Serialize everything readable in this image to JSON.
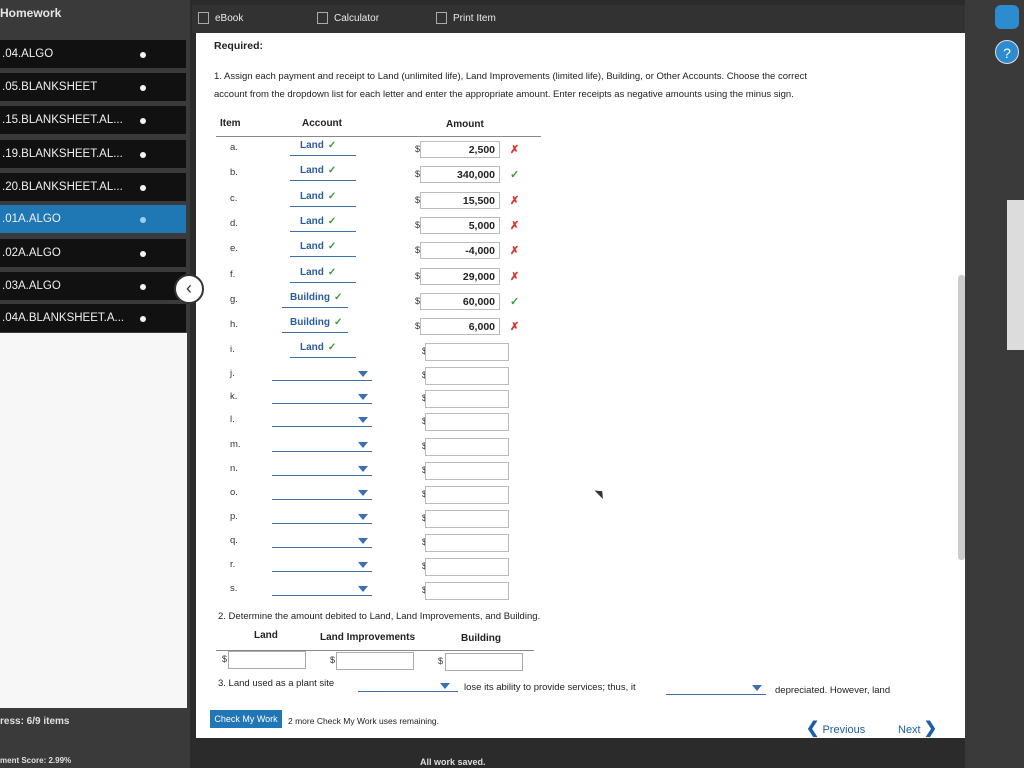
{
  "sidebar": {
    "title": "Homework",
    "items": [
      {
        "label": ".04.ALGO"
      },
      {
        "label": ".05.BLANKSHEET"
      },
      {
        "label": ".15.BLANKSHEET.AL..."
      },
      {
        "label": ".19.BLANKSHEET.AL..."
      },
      {
        "label": ".20.BLANKSHEET.AL..."
      },
      {
        "label": ".01A.ALGO"
      },
      {
        "label": ".02A.ALGO"
      },
      {
        "label": ".03A.ALGO"
      },
      {
        "label": ".04A.BLANKSHEET.A..."
      }
    ],
    "progress": "ress: 6/9 items",
    "score": "ment Score: 2.99%"
  },
  "toolbar": {
    "ebook": "eBook",
    "calculator": "Calculator",
    "print": "Print Item"
  },
  "main": {
    "required": "Required:",
    "q1_line1": "1. Assign each payment and receipt to Land (unlimited life), Land Improvements (limited life), Building, or Other Accounts. Choose the correct",
    "q1_line2": "account from the dropdown list for each letter and enter the appropriate amount. Enter receipts as negative amounts using the minus sign.",
    "table_headers": {
      "item": "Item",
      "account": "Account",
      "amount": "Amount"
    },
    "rows": [
      {
        "item": "a.",
        "account": "Land",
        "amount": "2,500",
        "status": "wrong"
      },
      {
        "item": "b.",
        "account": "Land",
        "amount": "340,000",
        "status": "right"
      },
      {
        "item": "c.",
        "account": "Land",
        "amount": "15,500",
        "status": "wrong"
      },
      {
        "item": "d.",
        "account": "Land",
        "amount": "5,000",
        "status": "wrong"
      },
      {
        "item": "e.",
        "account": "Land",
        "amount": "-4,000",
        "status": "wrong"
      },
      {
        "item": "f.",
        "account": "Land",
        "amount": "29,000",
        "status": "wrong"
      },
      {
        "item": "g.",
        "account": "Building",
        "amount": "60,000",
        "status": "right"
      },
      {
        "item": "h.",
        "account": "Building",
        "amount": "6,000",
        "status": "wrong"
      },
      {
        "item": "i.",
        "account": "Land",
        "amount": "",
        "status": ""
      },
      {
        "item": "j.",
        "account": "",
        "amount": "",
        "status": ""
      },
      {
        "item": "k.",
        "account": "",
        "amount": "",
        "status": ""
      },
      {
        "item": "l.",
        "account": "",
        "amount": "",
        "status": ""
      },
      {
        "item": "m.",
        "account": "",
        "amount": "",
        "status": ""
      },
      {
        "item": "n.",
        "account": "",
        "amount": "",
        "status": ""
      },
      {
        "item": "o.",
        "account": "",
        "amount": "",
        "status": ""
      },
      {
        "item": "p.",
        "account": "",
        "amount": "",
        "status": ""
      },
      {
        "item": "q.",
        "account": "",
        "amount": "",
        "status": ""
      },
      {
        "item": "r.",
        "account": "",
        "amount": "",
        "status": ""
      },
      {
        "item": "s.",
        "account": "",
        "amount": "",
        "status": ""
      }
    ],
    "check_right": "✓",
    "check_wrong": "✗",
    "dollar": "$",
    "q2": "2. Determine the amount debited to Land, Land Improvements, and Building.",
    "q2_headers": {
      "land": "Land",
      "land_improvements": "Land Improvements",
      "building": "Building"
    },
    "q3_start": "3. Land used as a plant site",
    "q3_mid": "lose its ability to provide services; thus, it",
    "q3_end": "depreciated. However, land"
  },
  "footer": {
    "check_button": "Check My Work",
    "check_remaining": "2 more Check My Work uses remaining.",
    "previous": "Previous",
    "next": "Next",
    "saved": "All work saved."
  },
  "help": {
    "icon": "?"
  },
  "colors": {
    "accent": "#2176b5",
    "right": "#3a9a3a",
    "wrong": "#d9342b"
  }
}
